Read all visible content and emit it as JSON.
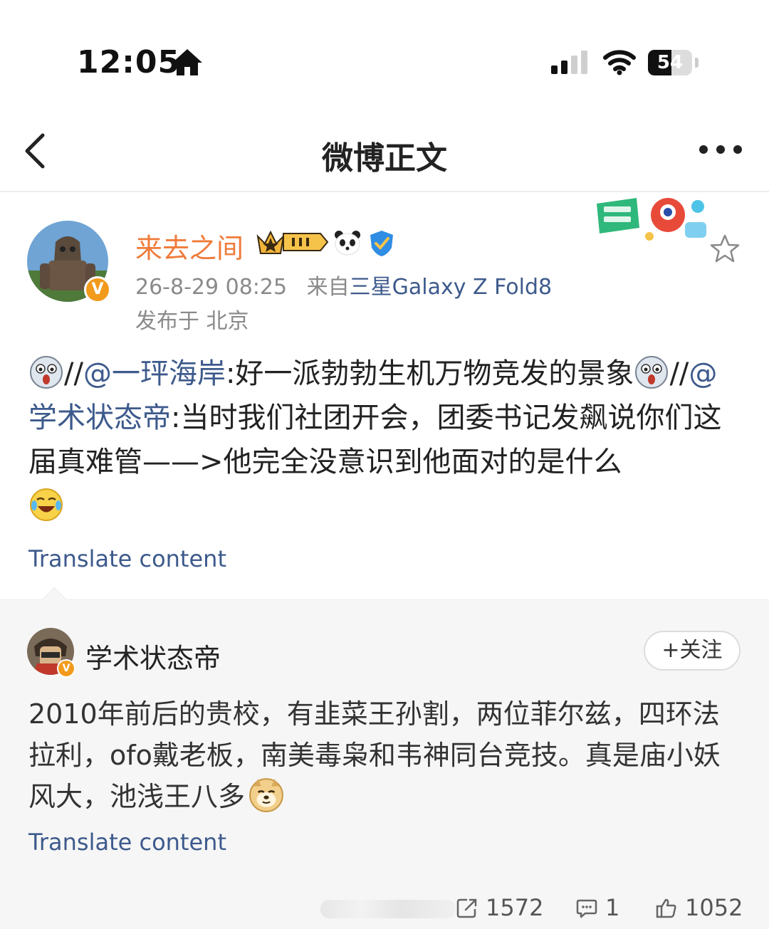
{
  "status_bar": {
    "time": "12:05",
    "battery": "54",
    "battery_level": 0.54
  },
  "nav": {
    "title": "微博正文"
  },
  "post": {
    "user_name": "来去之间",
    "timestamp": "26-8-29 08:25",
    "source_prefix": "来自",
    "device": "三星Galaxy Z Fold8",
    "location": "发布于 北京",
    "text_mention_sep_1": "//",
    "mention_1": "@一玶海岸",
    "text_1": ":好一派勃勃生机万物竞发的景象",
    "text_mention_sep_2": "//",
    "mention_2": "@学术状态帝",
    "text_2": ":当时我们社团开会，团委书记发飙说你们这届真难管——>他完全没意识到他面对的是什么",
    "translate": "Translate content"
  },
  "repost": {
    "user_name": "学术状态帝",
    "follow_label": "+关注",
    "text": "2010年前后的贵校，有韭菜王孙割，两位菲尔兹，四环法拉利，ofo戴老板，南美毒枭和韦神同台竞技。真是庙小妖风大，池浅王八多",
    "translate": "Translate content"
  },
  "actions": {
    "reposts": "1572",
    "comments": "1",
    "likes": "1052"
  },
  "colors": {
    "name_orange": "#f07b3a",
    "link_blue": "#3d5a8c",
    "verified": "#f29a1c"
  }
}
